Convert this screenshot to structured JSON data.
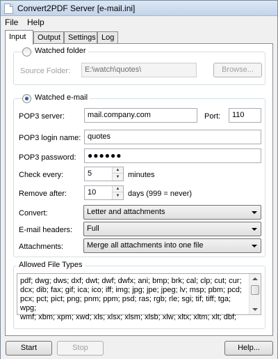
{
  "window": {
    "title": "Convert2PDF Server [e-mail.ini]"
  },
  "menu": {
    "items": [
      "File",
      "Help"
    ]
  },
  "tabs": [
    "Input",
    "Output",
    "Settings",
    "Log"
  ],
  "watched_folder": {
    "label": "Watched folder",
    "selected": false,
    "source_folder_label": "Source Folder:",
    "source_folder_value": "E:\\watch\\quotes\\",
    "browse_label": "Browse..."
  },
  "watched_email": {
    "label": "Watched e-mail",
    "selected": true,
    "pop3_server_label": "POP3 server:",
    "pop3_server_value": "mail.company.com",
    "port_label": "Port:",
    "port_value": "110",
    "login_label": "POP3 login name:",
    "login_value": "quotes",
    "password_label": "POP3 password:",
    "password_value": "●●●●●●",
    "check_label": "Check every:",
    "check_value": "5",
    "check_unit": "minutes",
    "remove_label": "Remove after:",
    "remove_value": "10",
    "remove_unit": "days (999 = never)",
    "convert_label": "Convert:",
    "convert_value": "Letter and attachments",
    "headers_label": "E-mail headers:",
    "headers_value": "Full",
    "attachments_label": "Attachments:",
    "attachments_value": "Merge all attachments into one file"
  },
  "file_types": {
    "label": "Allowed File Types",
    "lines": [
      "pdf; dwg; dws; dxf; dwt; dwf; dwfx; ani; bmp; brk; cal; clp; cut; cur;",
      "dcx; dib; fax; gif; ica; ico; iff; img; jpg; jpe; jpeg; lv; msp; pbm; pcd;",
      "pcx; pct; pict; png; pnm; ppm; psd; ras; rgb; rle; sgi; tif; tiff; tga; wpg;",
      "wmf; xbm; xpm; xwd; xls; xlsx; xlsm; xlsb; xlw; xltx; xltm; xlt; dbf;"
    ]
  },
  "bottom": {
    "start_label": "Start",
    "stop_label": "Stop",
    "help_label": "Help..."
  }
}
